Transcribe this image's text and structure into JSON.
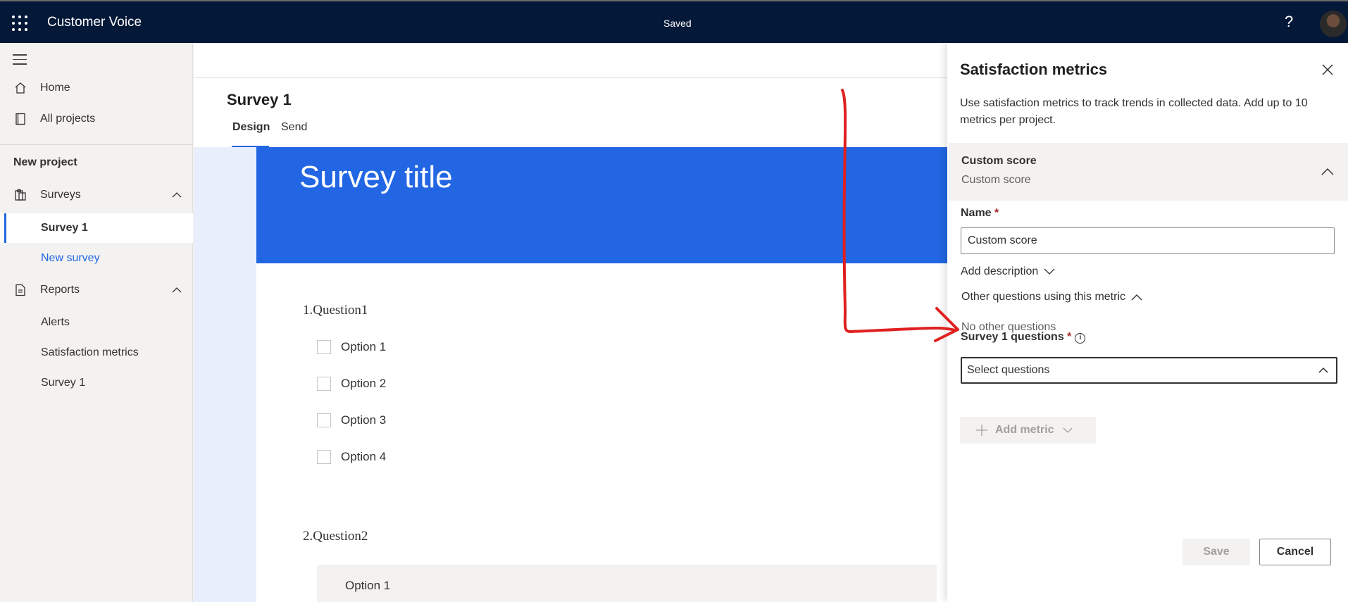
{
  "topbar": {
    "app_title": "Customer Voice",
    "status": "Saved",
    "help_icon": "question-mark-icon"
  },
  "leftnav": {
    "home": "Home",
    "all_projects": "All projects",
    "section_title": "New project",
    "surveys": "Surveys",
    "survey_items": [
      "Survey 1",
      "New survey"
    ],
    "reports": "Reports",
    "report_items": [
      "Alerts",
      "Satisfaction metrics",
      "Survey 1"
    ]
  },
  "main": {
    "survey_name": "Survey 1",
    "tabs": [
      "Design",
      "Send"
    ],
    "active_tab": "Design",
    "banner_title": "Survey title",
    "questions": [
      {
        "number": "1.",
        "title": "Question1",
        "options": [
          "Option 1",
          "Option 2",
          "Option 3",
          "Option 4"
        ]
      },
      {
        "number": "2.",
        "title": "Question2",
        "options": [
          "Option 1"
        ]
      }
    ]
  },
  "panel": {
    "title": "Satisfaction metrics",
    "description": "Use satisfaction metrics to track trends in collected data. Add up to 10 metrics per project.",
    "metric": {
      "name": "Custom score",
      "type": "Custom score",
      "name_label": "Name",
      "name_value": "Custom score",
      "add_description": "Add description",
      "questions_label": "Survey 1 questions",
      "questions_placeholder": "Select questions",
      "other_questions": "Other questions using this metric",
      "no_other": "No other questions"
    },
    "add_metric": "Add metric",
    "save": "Save",
    "cancel": "Cancel"
  },
  "colors": {
    "topbar": "#041838",
    "accent": "#2266e3",
    "annotation": "#e02020"
  }
}
